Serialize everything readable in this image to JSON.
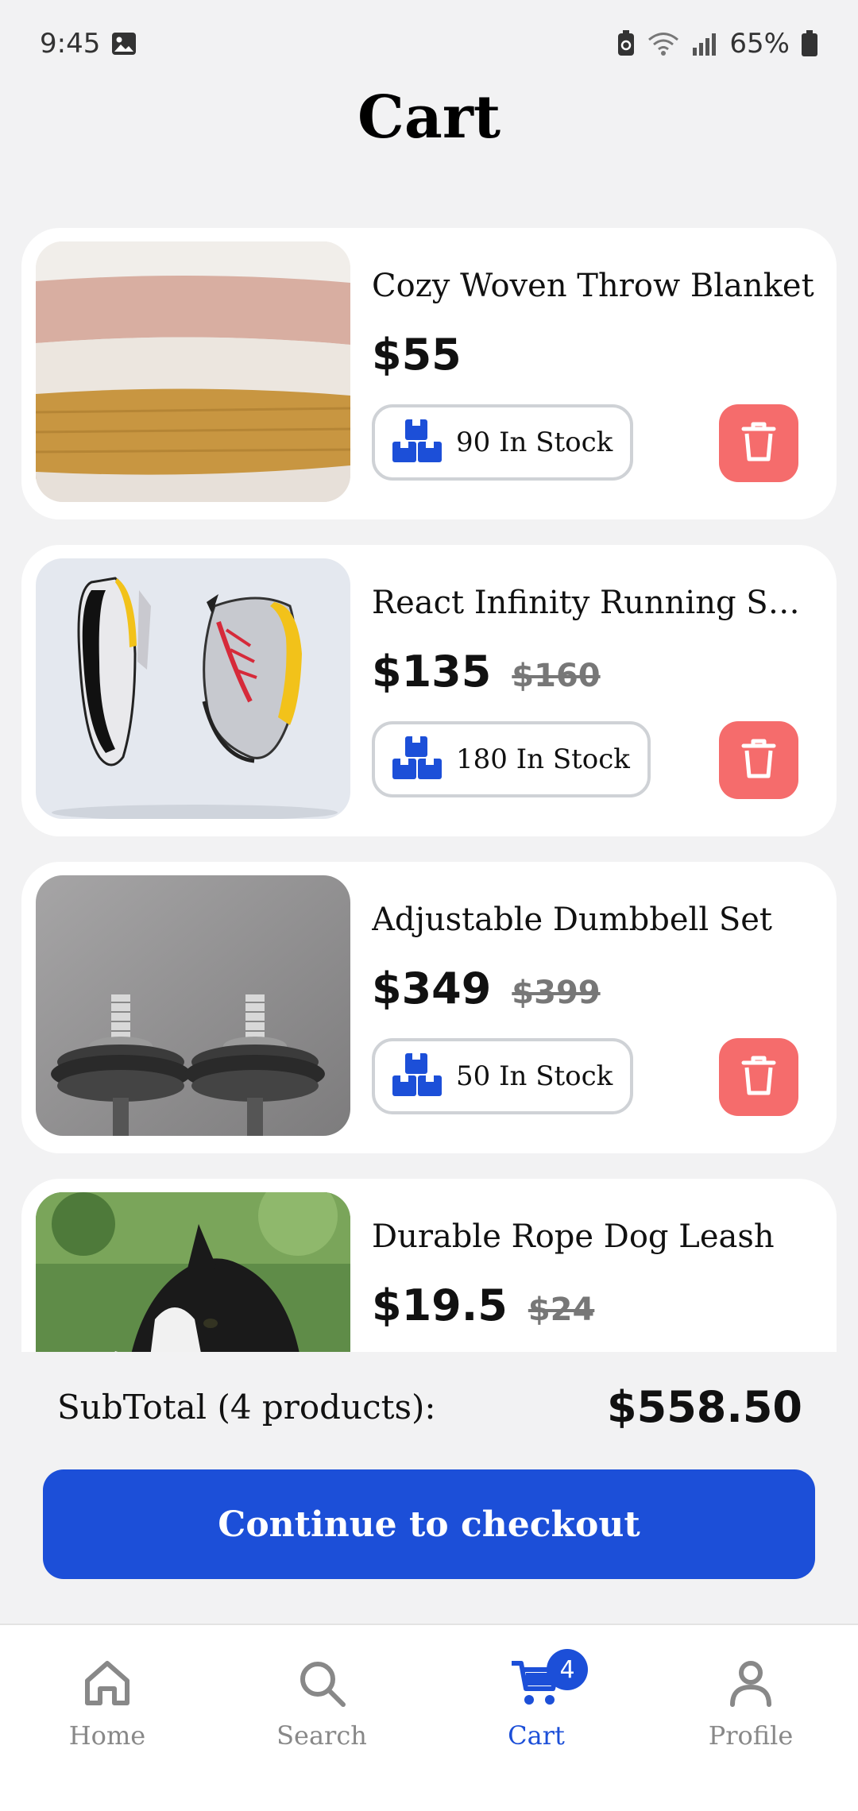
{
  "status_bar": {
    "time": "9:45",
    "battery": "65%"
  },
  "header": {
    "title": "Cart"
  },
  "cart": {
    "items": [
      {
        "name": "Cozy Woven Throw Blanket",
        "price": "$55",
        "old_price": "",
        "stock": "90 In Stock"
      },
      {
        "name": "React Infinity Running Sh...",
        "price": "$135",
        "old_price": "$160",
        "stock": "180 In Stock"
      },
      {
        "name": "Adjustable Dumbbell Set",
        "price": "$349",
        "old_price": "$399",
        "stock": "50 In Stock"
      },
      {
        "name": "Durable Rope Dog Leash",
        "price": "$19.5",
        "old_price": "$24",
        "stock": ""
      }
    ]
  },
  "summary": {
    "subtotal_label": "SubTotal (4 products):",
    "subtotal_value": "$558.50",
    "checkout_label": "Continue to checkout"
  },
  "nav": {
    "items": [
      {
        "label": "Home",
        "icon": "home-icon"
      },
      {
        "label": "Search",
        "icon": "search-icon"
      },
      {
        "label": "Cart",
        "icon": "cart-icon",
        "badge": "4"
      },
      {
        "label": "Profile",
        "icon": "profile-icon"
      }
    ]
  },
  "colors": {
    "accent": "#1c4fd8",
    "delete": "#f56c6c",
    "background": "#f2f2f3"
  }
}
